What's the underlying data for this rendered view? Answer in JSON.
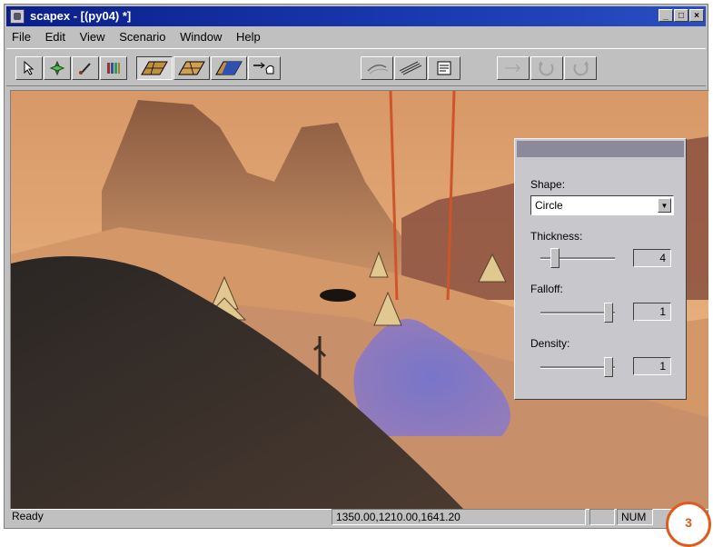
{
  "window": {
    "title": "scapex - [(py04) *]"
  },
  "window_controls": {
    "minimize": "_",
    "maximize": "□",
    "close": "×"
  },
  "menu": {
    "items": [
      "File",
      "Edit",
      "View",
      "Scenario",
      "Window",
      "Help"
    ]
  },
  "toolbar": {
    "buttons": [
      {
        "icon": "pointer-icon"
      },
      {
        "icon": "target-icon"
      },
      {
        "icon": "brush-icon"
      },
      {
        "icon": "books-icon"
      },
      {
        "icon": "terrain-grid-icon"
      },
      {
        "icon": "terrain-flat-icon"
      },
      {
        "icon": "terrain-water-icon"
      },
      {
        "icon": "hand-arrow-icon"
      },
      {
        "icon": "wind-icon"
      },
      {
        "icon": "wave-lines-icon"
      },
      {
        "icon": "properties-icon"
      },
      {
        "icon": "arrow-right-icon"
      },
      {
        "icon": "redo-icon"
      },
      {
        "icon": "undo-icon"
      }
    ]
  },
  "panel": {
    "shape_label": "Shape:",
    "shape_value": "Circle",
    "thickness_label": "Thickness:",
    "thickness_value": "4",
    "thickness_level": 0.2,
    "falloff_label": "Falloff:",
    "falloff_value": "1",
    "falloff_level": 0.92,
    "density_label": "Density:",
    "density_value": "1",
    "density_level": 0.92
  },
  "status": {
    "text": "Ready",
    "coords": "1350.00,1210.00,1641.20",
    "num": "NUM"
  },
  "badge": {
    "number": "3"
  },
  "colors": {
    "titlebar": "#0a1f8a",
    "accent": "#e05a1e",
    "sky": "#e8b07a"
  }
}
